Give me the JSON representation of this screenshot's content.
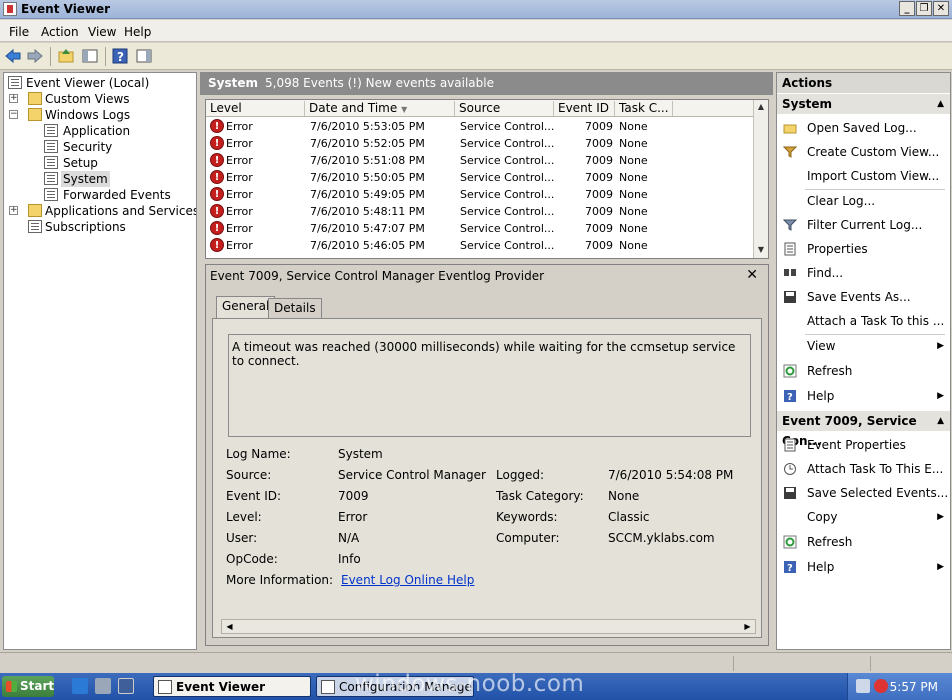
{
  "window": {
    "title": "Event Viewer"
  },
  "menu": [
    "File",
    "Action",
    "View",
    "Help"
  ],
  "tree": {
    "root": "Event Viewer (Local)",
    "custom_views": "Custom Views",
    "windows_logs": "Windows Logs",
    "application": "Application",
    "security": "Security",
    "setup": "Setup",
    "system": "System",
    "forwarded": "Forwarded Events",
    "apps_services": "Applications and Services Logs",
    "subscriptions": "Subscriptions"
  },
  "center_header": {
    "title": "System",
    "info": "5,098 Events (!) New events available"
  },
  "grid": {
    "columns": [
      "Level",
      "Date and Time",
      "Source",
      "Event ID",
      "Task C..."
    ],
    "rows": [
      {
        "level": "Error",
        "date": "7/6/2010 5:53:05 PM",
        "source": "Service Control...",
        "id": "7009",
        "task": "None"
      },
      {
        "level": "Error",
        "date": "7/6/2010 5:52:05 PM",
        "source": "Service Control...",
        "id": "7009",
        "task": "None"
      },
      {
        "level": "Error",
        "date": "7/6/2010 5:51:08 PM",
        "source": "Service Control...",
        "id": "7009",
        "task": "None"
      },
      {
        "level": "Error",
        "date": "7/6/2010 5:50:05 PM",
        "source": "Service Control...",
        "id": "7009",
        "task": "None"
      },
      {
        "level": "Error",
        "date": "7/6/2010 5:49:05 PM",
        "source": "Service Control...",
        "id": "7009",
        "task": "None"
      },
      {
        "level": "Error",
        "date": "7/6/2010 5:48:11 PM",
        "source": "Service Control...",
        "id": "7009",
        "task": "None"
      },
      {
        "level": "Error",
        "date": "7/6/2010 5:47:07 PM",
        "source": "Service Control...",
        "id": "7009",
        "task": "None"
      },
      {
        "level": "Error",
        "date": "7/6/2010 5:46:05 PM",
        "source": "Service Control...",
        "id": "7009",
        "task": "None"
      }
    ]
  },
  "detail": {
    "title": "Event 7009, Service Control Manager Eventlog Provider",
    "tab_general": "General",
    "tab_details": "Details",
    "message": "A timeout was reached (30000 milliseconds) while waiting for the ccmsetup service to connect.",
    "log_name_label": "Log Name:",
    "log_name": "System",
    "source_label": "Source:",
    "source": "Service Control Manager Eve",
    "logged_label": "Logged:",
    "logged": "7/6/2010 5:54:08 PM",
    "event_id_label": "Event ID:",
    "event_id": "7009",
    "task_cat_label": "Task Category:",
    "task_cat": "None",
    "level_label": "Level:",
    "level": "Error",
    "keywords_label": "Keywords:",
    "keywords": "Classic",
    "user_label": "User:",
    "user": "N/A",
    "computer_label": "Computer:",
    "computer": "SCCM.yklabs.com",
    "opcode_label": "OpCode:",
    "opcode": "Info",
    "more_info_label": "More Information:",
    "more_info_link": "Event Log Online Help"
  },
  "actions": {
    "header": "Actions",
    "section1": "System",
    "items1": [
      {
        "label": "Open Saved Log...",
        "icon": "folder-open-icon"
      },
      {
        "label": "Create Custom View...",
        "icon": "filter-icon"
      },
      {
        "label": "Import Custom View...",
        "icon": ""
      },
      {
        "label": "Clear Log...",
        "icon": ""
      },
      {
        "label": "Filter Current Log...",
        "icon": "filter-icon"
      },
      {
        "label": "Properties",
        "icon": "properties-icon"
      },
      {
        "label": "Find...",
        "icon": "find-icon"
      },
      {
        "label": "Save Events As...",
        "icon": "save-icon"
      },
      {
        "label": "Attach a Task To this ...",
        "icon": ""
      },
      {
        "label": "View",
        "icon": ""
      },
      {
        "label": "Refresh",
        "icon": "refresh-icon"
      },
      {
        "label": "Help",
        "icon": "help-icon"
      }
    ],
    "section2": "Event 7009, Service Con...",
    "items2": [
      {
        "label": "Event Properties",
        "icon": "properties-icon"
      },
      {
        "label": "Attach Task To This E...",
        "icon": "task-icon"
      },
      {
        "label": "Save Selected Events...",
        "icon": "save-icon"
      },
      {
        "label": "Copy",
        "icon": ""
      },
      {
        "label": "Refresh",
        "icon": "refresh-icon"
      },
      {
        "label": "Help",
        "icon": "help-icon"
      }
    ]
  },
  "taskbar": {
    "start": "Start",
    "task1": "Event Viewer",
    "task2": "Configuration Manager C...",
    "clock": "5:57 PM",
    "watermark": "windows-noob.com"
  },
  "colors": {
    "error": "#c41f1f",
    "link": "#0033cc",
    "header_bg": "#8b8b8b"
  }
}
